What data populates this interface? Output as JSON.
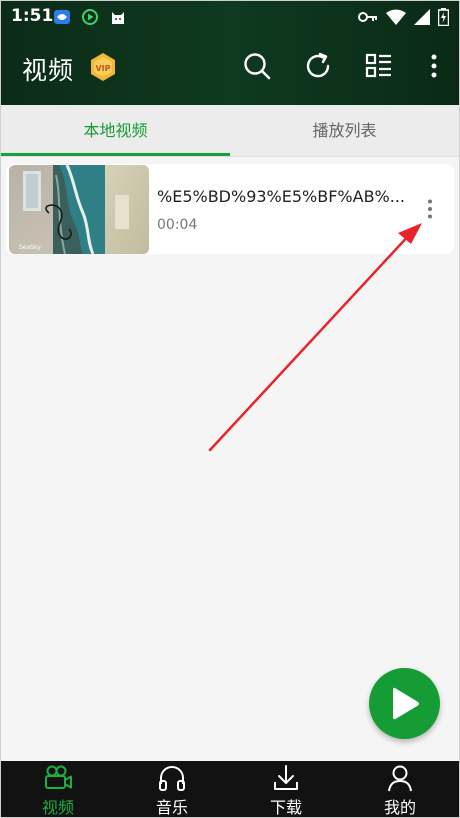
{
  "status_bar": {
    "time": "1:51"
  },
  "header": {
    "title": "视频",
    "vip_badge": "VIP"
  },
  "tabs": [
    {
      "label": "本地视频",
      "active": true
    },
    {
      "label": "播放列表",
      "active": false
    }
  ],
  "videos": [
    {
      "name": "%E5%BD%93%E5%BF%AB%...",
      "duration": "00:04"
    }
  ],
  "bottom_nav": [
    {
      "label": "视频",
      "icon": "video-camera-icon",
      "active": true
    },
    {
      "label": "音乐",
      "icon": "headphones-icon",
      "active": false
    },
    {
      "label": "下载",
      "icon": "download-icon",
      "active": false
    },
    {
      "label": "我的",
      "icon": "person-icon",
      "active": false
    }
  ],
  "colors": {
    "accent": "#169c35",
    "header_bg": "#0f3a1f",
    "nav_bg": "#121212",
    "arrow": "#e8232a"
  }
}
